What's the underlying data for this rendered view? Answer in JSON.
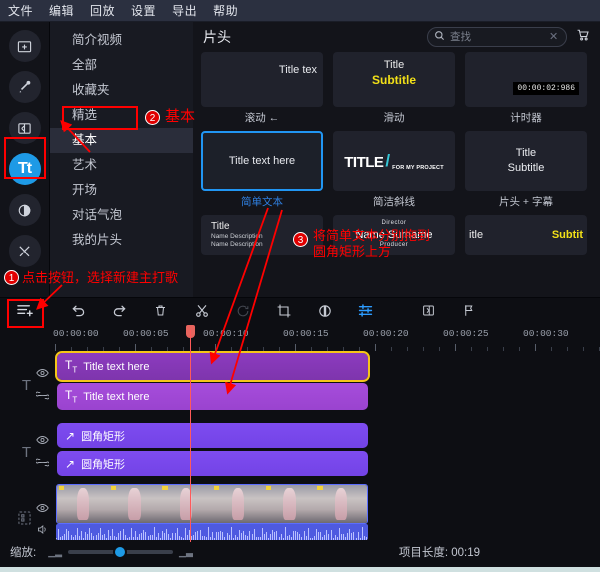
{
  "menubar": {
    "items": [
      "文件",
      "编辑",
      "回放",
      "设置",
      "导出",
      "帮助"
    ]
  },
  "rail": {
    "items": [
      {
        "name": "media-import",
        "icon": "folder-plus-icon"
      },
      {
        "name": "effects",
        "icon": "magic-wand-icon"
      },
      {
        "name": "transitions",
        "icon": "transition-icon"
      },
      {
        "name": "titles",
        "icon": "text-tt-icon",
        "label": "Tt"
      },
      {
        "name": "color",
        "icon": "color-wheel-icon"
      },
      {
        "name": "tools",
        "icon": "tools-icon"
      }
    ]
  },
  "categories": {
    "items": [
      "简介视频",
      "全部",
      "收藏夹",
      "精选",
      "基本",
      "艺术",
      "开场",
      "对话气泡",
      "我的片头"
    ],
    "selected": "基本"
  },
  "library": {
    "title": "片头",
    "search": {
      "placeholder": "查找",
      "value": ""
    },
    "templates": [
      {
        "caption": "滚动 ←",
        "kind": "right-text",
        "text": "Title tex"
      },
      {
        "caption": "滑动",
        "kind": "title-subtitle-yellow",
        "line1": "Title",
        "line2": "Subtitle"
      },
      {
        "caption": "计时器",
        "kind": "timer",
        "timecode": "00:00:02:986"
      },
      {
        "caption": "简单文本",
        "kind": "plain",
        "text": "Title text here",
        "selected": true
      },
      {
        "caption": "简洁斜线",
        "kind": "title-slash",
        "big": "TITLE",
        "small": "FOR MY PROJECT"
      },
      {
        "caption": "片头 + 字幕",
        "kind": "two-line",
        "line1": "Title",
        "line2": "Subtitle"
      },
      {
        "caption": "",
        "kind": "credits",
        "c1": "Title",
        "c2": "Name Description",
        "c3": "Name Description"
      },
      {
        "caption": "",
        "kind": "director",
        "d1": "Director",
        "d2": "Name Surname",
        "d3": "Producer"
      },
      {
        "caption": "",
        "kind": "slide-partial",
        "s1": "itle",
        "s2": "Subtit"
      }
    ]
  },
  "timeline": {
    "toolbar": [
      {
        "name": "undo-button",
        "icon": "undo-icon"
      },
      {
        "name": "redo-button",
        "icon": "redo-icon"
      },
      {
        "name": "delete-button",
        "icon": "trash-icon"
      },
      {
        "name": "split-button",
        "icon": "scissors-icon"
      },
      {
        "name": "rotate-button",
        "icon": "rotate-icon"
      },
      {
        "name": "crop-button",
        "icon": "crop-icon"
      },
      {
        "name": "speed-button",
        "icon": "speed-icon"
      },
      {
        "name": "adjust-button",
        "icon": "sliders-icon"
      },
      {
        "name": "duplicate-button",
        "icon": "duplicate-icon"
      },
      {
        "name": "marker-button",
        "icon": "flag-icon"
      }
    ],
    "ruler_labels": [
      "00:00:00",
      "00:00:05",
      "00:00:10",
      "00:00:15",
      "00:00:20",
      "00:00:25",
      "00:00:30"
    ],
    "clips": [
      {
        "label": "Title text here",
        "icon": "text-tt-icon",
        "selected": true
      },
      {
        "label": "Title text here",
        "icon": "text-tt-icon",
        "selected": false
      },
      {
        "label": "圆角矩形",
        "icon": "shape-arrow-icon",
        "selected": false
      },
      {
        "label": "圆角矩形",
        "icon": "shape-arrow-icon",
        "selected": false
      }
    ],
    "track_headers": [
      {
        "name": "text-track-1",
        "type": "T",
        "icons": [
          "eye-icon",
          "link-icon"
        ]
      },
      {
        "name": "text-track-2",
        "type": "T",
        "icons": [
          "eye-icon",
          "link-icon"
        ]
      },
      {
        "name": "video-track",
        "type": "film",
        "icons": [
          "eye-icon",
          "speaker-icon"
        ]
      }
    ],
    "add_track_icon": "add-track-icon"
  },
  "bottom": {
    "zoom_label": "缩放:",
    "project_length_label": "项目长度: 00:19"
  },
  "annotations": [
    {
      "num": "1",
      "text": "点击按钮，选择新建主打歌"
    },
    {
      "num": "2",
      "text": "基本"
    },
    {
      "num": "3",
      "text": "将简单文本分别拖到\n圆角矩形上方"
    }
  ]
}
